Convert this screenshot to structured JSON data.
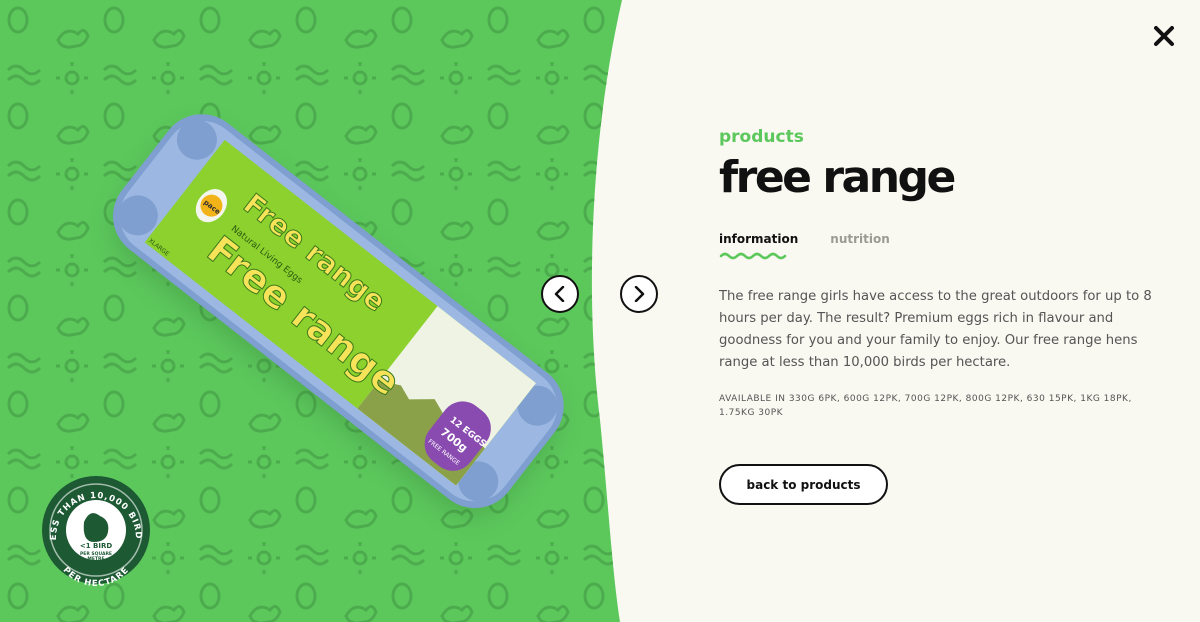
{
  "colors": {
    "accent": "#5cc85c",
    "pattern": "#4aa84a",
    "background": "#f9f8f1",
    "badge": "#1d5a34"
  },
  "product": {
    "category": "products",
    "title": "free range",
    "tabs": [
      {
        "label": "information",
        "active": true
      },
      {
        "label": "nutrition",
        "active": false
      }
    ],
    "description": "The free range girls have access to the great outdoors for up to 8 hours per day. The result? Premium eggs rich in flavour and goodness for you and your family to enjoy. Our free range hens range at less than 10,000 birds per hectare.",
    "availability": "AVAILABLE IN 330G 6PK, 600G 12PK, 700G 12PK, 800G 12PK, 630 15PK, 1KG 18PK, 1.75KG 30PK",
    "back_label": "back to products"
  },
  "carousel": {
    "prev_icon": "chevron-left-icon",
    "next_icon": "chevron-right-icon"
  },
  "close_icon": "close-icon",
  "packaging": {
    "brand": "pace",
    "name": "Free range",
    "tagline": "Natural Living Eggs",
    "size": "XLARGE",
    "count": "12 EGGS",
    "weight": "700g",
    "pack_label": "FREE RANGE"
  },
  "badge": {
    "ring_text": "LESS THAN 10,000 BIRDS",
    "ring_bottom": "PER HECTARE",
    "center_main": "<1 BIRD",
    "center_sub_1": "PER SQUARE",
    "center_sub_2": "METRE"
  }
}
